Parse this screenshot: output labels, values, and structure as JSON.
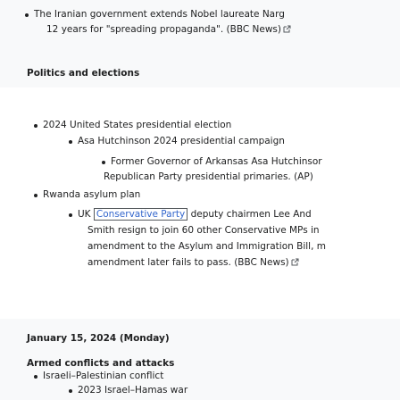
{
  "top_story": {
    "line1": "The Iranian government extends Nobel laureate Narg",
    "line2": "12 years for \"spreading propaganda\". (BBC News)"
  },
  "politics_heading": "Politics and elections",
  "items": {
    "election": "2024 United States presidential election",
    "campaign": "Asa Hutchinson 2024 presidential campaign",
    "governor_line1": "Former Governor of Arkansas Asa Hutchinsor",
    "governor_line2": "Republican Party presidential primaries. (AP)",
    "rwanda": "Rwanda asylum plan",
    "uk_prefix": "UK",
    "uk_boxed": "Conservative Party",
    "uk_line1_rest": "deputy chairmen Lee And",
    "uk_line2": "Smith resign to join 60 other Conservative MPs in",
    "uk_line3": "amendment to the Asylum and Immigration Bill, m",
    "uk_line4": "amendment later fails to pass. (BBC News)"
  },
  "date_heading": "January 15, 2024 (Monday)",
  "armed_heading": "Armed conflicts and attacks",
  "conflicts": {
    "israeli": "Israeli–Palestinian conflict",
    "war": "2023 Israel–Hamas war"
  },
  "icons": {
    "external": "external-link-icon"
  },
  "colors": {
    "link": "#3366cc",
    "text": "#202122",
    "panel_bg": "#f8f9fa"
  }
}
